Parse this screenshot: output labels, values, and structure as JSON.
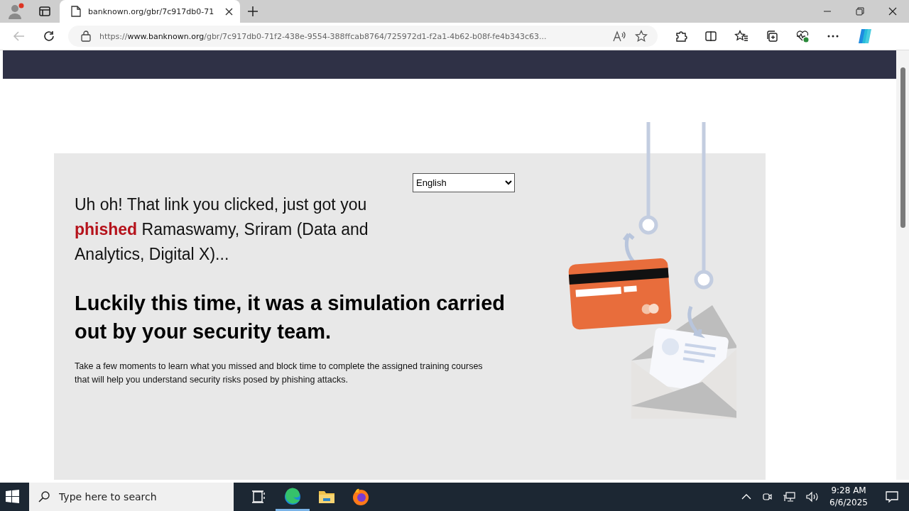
{
  "browser": {
    "tabs": [
      {
        "title": "banknown.org/gbr/7c917db0-71",
        "selected": true
      }
    ],
    "url": {
      "scheme": "https://",
      "host": "www.banknown.org",
      "path": "/gbr/7c917db0-71f2-438e-9554-388ffcab8764/725972d1-f2a1-4b62-b08f-fe4b343c63..."
    }
  },
  "page": {
    "language_select": {
      "value": "English"
    },
    "message": "Uh oh! That link you clicked, just got you **phished** Ramaswamy, Sriram (Data and Analytics, Digital X)...",
    "headline": "Luckily this time, it was a simulation carried out by your security team.",
    "body": "Take a few moments to learn what you missed and block time to complete the assigned training courses that will help you understand security risks posed by phishing attacks."
  },
  "taskbar": {
    "search": {
      "placeholder": "Type here to search"
    },
    "time": "9:28 AM",
    "date": "6/6/2025"
  }
}
